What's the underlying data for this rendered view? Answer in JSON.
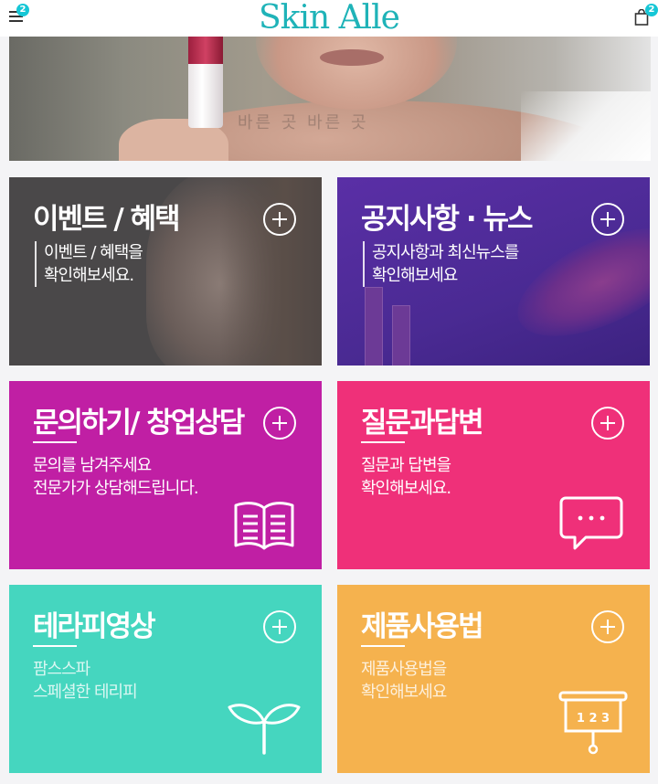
{
  "header": {
    "logo_text": "Skin Alle",
    "menu_badge": "2",
    "cart_badge": "2"
  },
  "hero": {
    "watermark": "바른 곳    바른 곳"
  },
  "tiles": {
    "event": {
      "title": "이벤트 / 혜택",
      "desc_line1": "이벤트 / 혜택을",
      "desc_line2": "확인해보세요."
    },
    "news": {
      "title": "공지사항 · 뉴스",
      "desc_line1": "공지사항과 최신뉴스를",
      "desc_line2": "확인해보세요"
    },
    "inquiry": {
      "title": "문의하기/ 창업상담",
      "desc_line1": "문의를 남겨주세요",
      "desc_line2": "전문가가 상담해드립니다."
    },
    "qna": {
      "title": "질문과답변",
      "desc_line1": "질문과 답변을",
      "desc_line2": "확인해보세요."
    },
    "therapy": {
      "title": "테라피영상",
      "desc_line1": "팜스스파",
      "desc_line2": "스페셜한 테리피"
    },
    "product": {
      "title": "제품사용법",
      "desc_line1": "제품사용법을",
      "desc_line2": "확인해보세요",
      "board_text": "1 2 3"
    }
  },
  "icons": {
    "menu": "hamburger-icon",
    "cart": "shopping-bag-icon",
    "expand": "plus-circle-icon",
    "inquiry": "open-book-icon",
    "qna": "chat-bubble-icon",
    "therapy": "sprout-icon",
    "product": "presentation-board-icon"
  },
  "colors": {
    "accent": "#16c7d6",
    "logo": "#1fb3b8",
    "event": "#4a4849",
    "news": "#4a2a93",
    "inquiry": "#c01fa4",
    "qna": "#ef3079",
    "therapy": "#45d6bf",
    "product": "#f5b24e"
  }
}
